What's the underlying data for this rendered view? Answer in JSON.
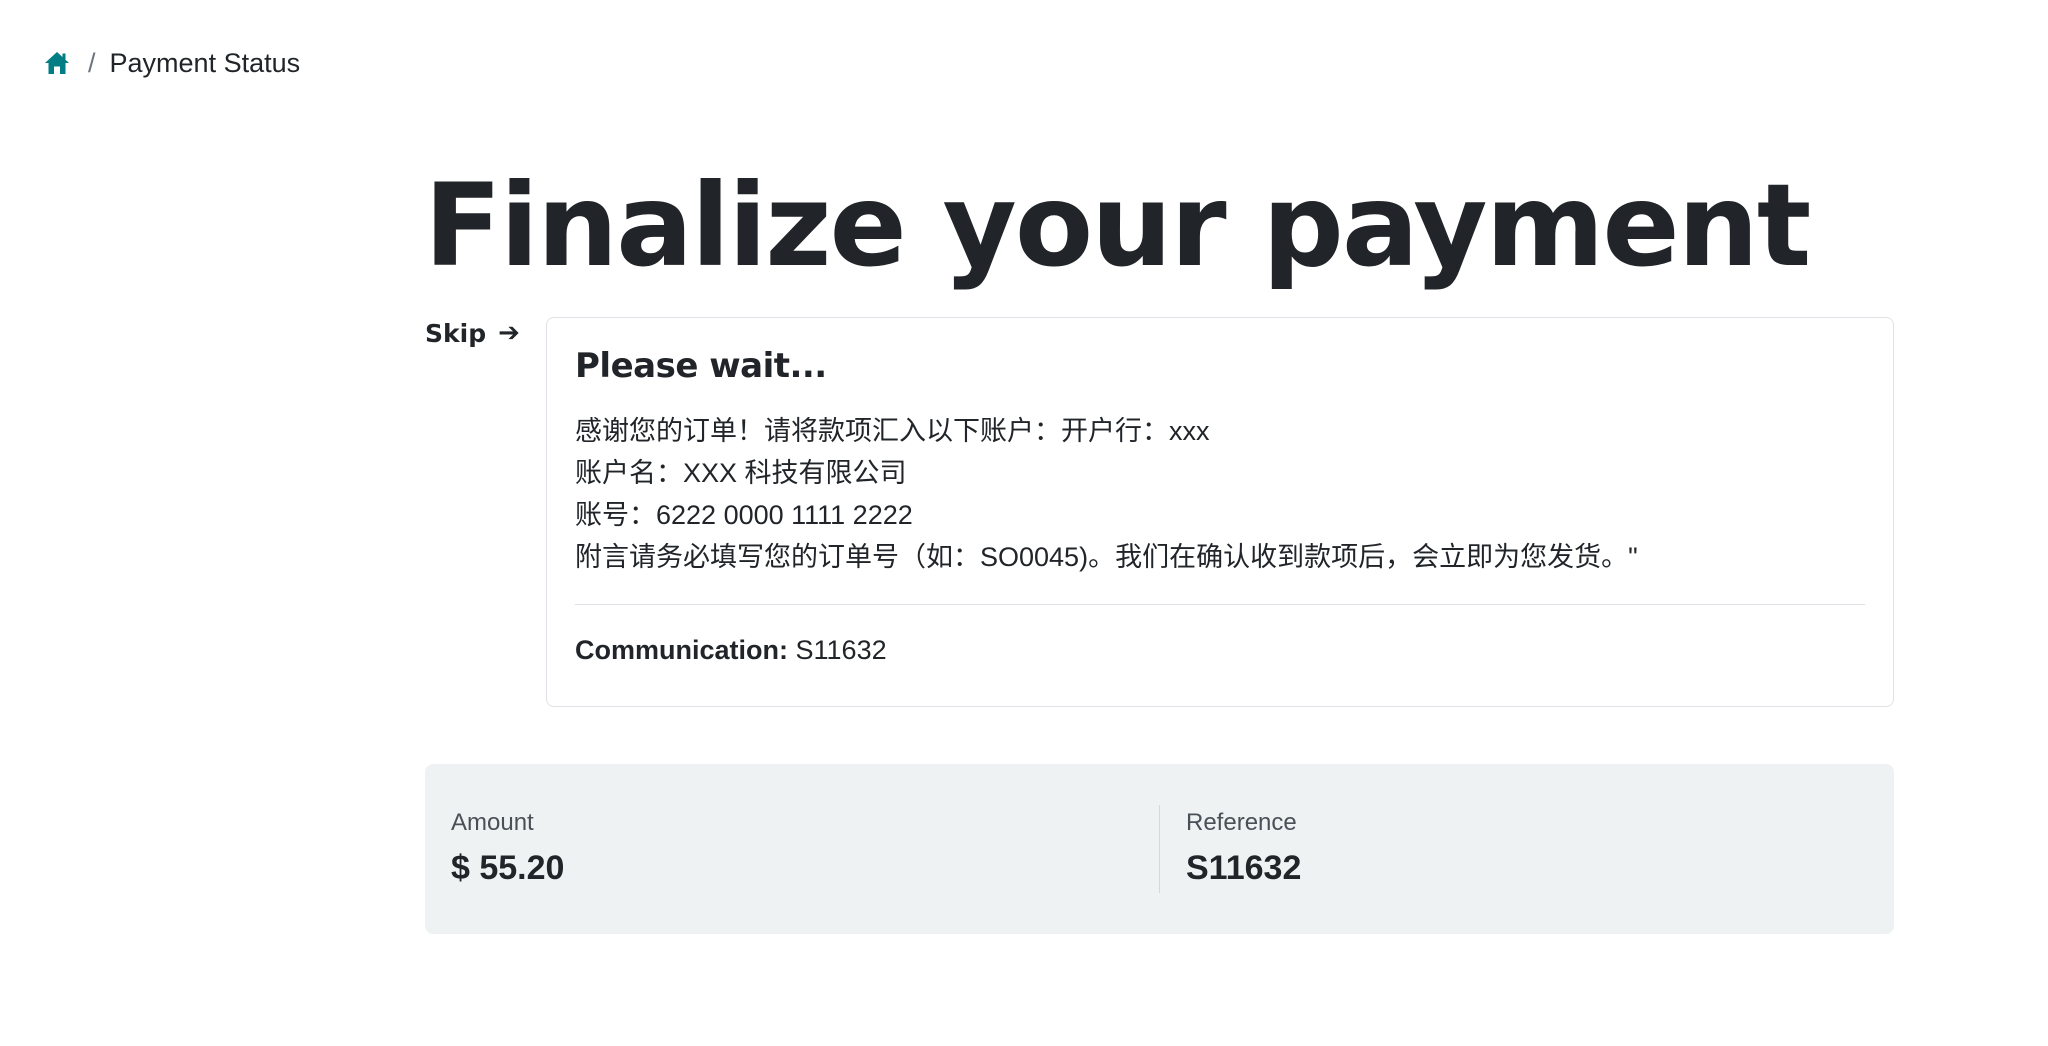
{
  "breadcrumb": {
    "home_icon": "home-icon",
    "separator": "/",
    "current": "Payment Status"
  },
  "page": {
    "title": "Finalize your payment",
    "skip_label": "Skip",
    "skip_icon": "arrow-right-icon"
  },
  "card": {
    "heading": "Please wait...",
    "lines": [
      "感谢您的订单！请将款项汇入以下账户：开户行：xxx",
      "账户名：XXX 科技有限公司",
      "账号：6222 0000 1111 2222",
      "附言请务必填写您的订单号（如：SO0045)。我们在确认收到款项后，会立即为您发货。\""
    ],
    "communication_label": "Communication:",
    "communication_value": "S11632"
  },
  "summary": {
    "amount_label": "Amount",
    "amount_value": "$ 55.20",
    "reference_label": "Reference",
    "reference_value": "S11632"
  },
  "colors": {
    "accent": "#017e84",
    "text": "#212529",
    "panel_bg": "#eff2f3",
    "border": "#dee2e6"
  }
}
